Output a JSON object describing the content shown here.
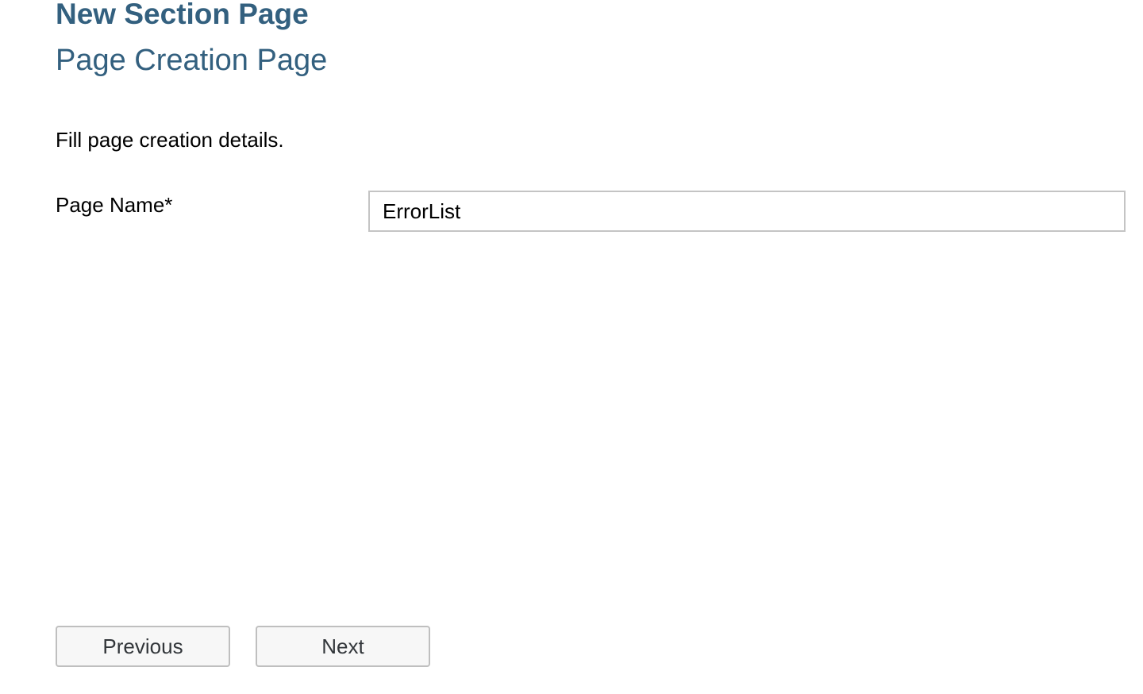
{
  "header": {
    "title": "New Section Page",
    "subtitle": "Page Creation Page"
  },
  "form": {
    "instructions": "Fill page creation details.",
    "page_name": {
      "label": "Page Name*",
      "value": "ErrorList",
      "placeholder": ""
    }
  },
  "navigation": {
    "previous_label": "Previous",
    "next_label": "Next"
  },
  "colors": {
    "heading": "#33607f",
    "button_bg": "#f7f7f7",
    "button_border": "#bfbfbf",
    "input_border": "#c4c4c4"
  }
}
